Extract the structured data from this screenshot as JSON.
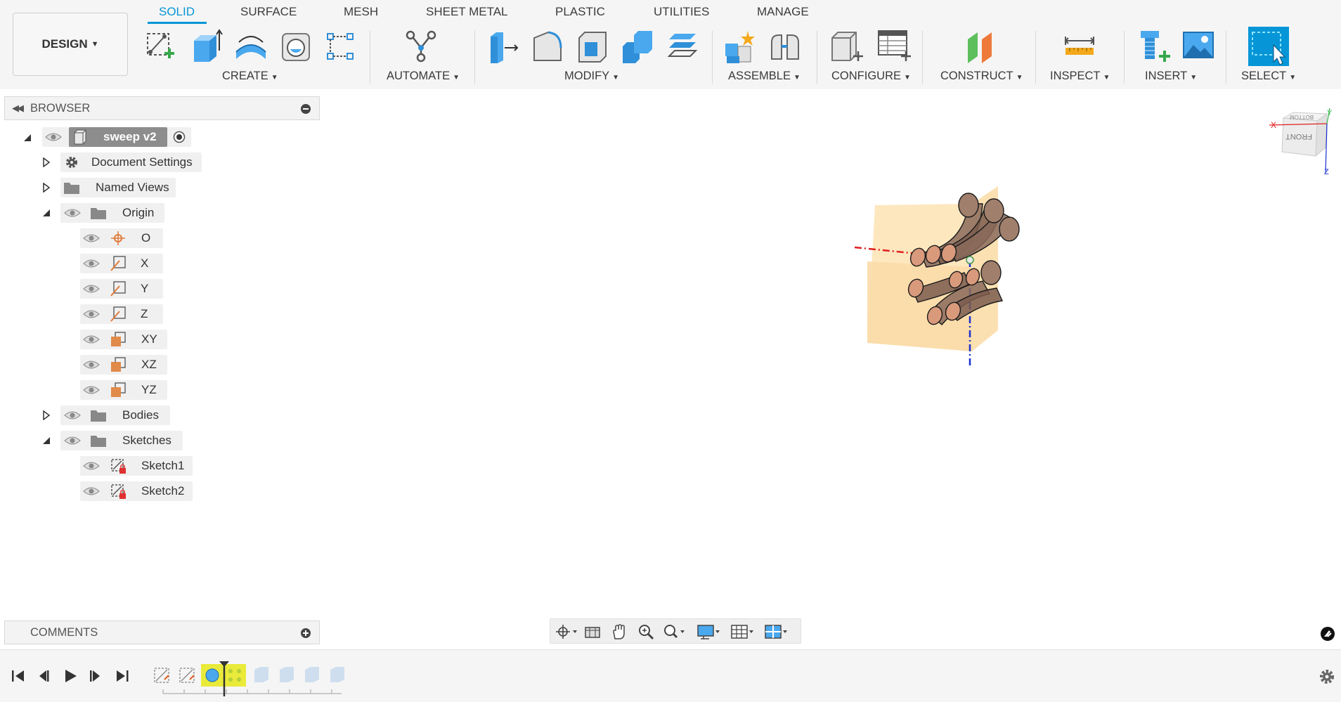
{
  "workspace": {
    "label": "DESIGN"
  },
  "tabs": [
    {
      "label": "SOLID",
      "active": true
    },
    {
      "label": "SURFACE"
    },
    {
      "label": "MESH"
    },
    {
      "label": "SHEET METAL"
    },
    {
      "label": "PLASTIC"
    },
    {
      "label": "UTILITIES"
    },
    {
      "label": "MANAGE"
    }
  ],
  "groups": {
    "create": "CREATE",
    "automate": "AUTOMATE",
    "modify": "MODIFY",
    "assemble": "ASSEMBLE",
    "configure": "CONFIGURE",
    "construct": "CONSTRUCT",
    "inspect": "INSPECT",
    "insert": "INSERT",
    "select": "SELECT"
  },
  "browser": {
    "title": "BROWSER",
    "root": "sweep v2",
    "items": {
      "document_settings": "Document Settings",
      "named_views": "Named Views",
      "origin": "Origin",
      "o": "O",
      "x": "X",
      "y": "Y",
      "z": "Z",
      "xy": "XY",
      "xz": "XZ",
      "yz": "YZ",
      "bodies": "Bodies",
      "sketches": "Sketches",
      "sketch1": "Sketch1",
      "sketch2": "Sketch2"
    }
  },
  "comments": {
    "title": "COMMENTS"
  },
  "viewcube": {
    "top_face": "BOTTOM",
    "front_face": "FRONT",
    "axis_x": "X",
    "axis_y": "Y",
    "axis_z": "Z"
  },
  "colors": {
    "accent": "#0696d7",
    "plane_fill": "#fde7bf",
    "tube_fill": "#8a6a5a",
    "tube_end": "#d99a7c",
    "axis_x": "#e02020",
    "axis_z": "#1a2fd0",
    "select_blue": "#0696d7"
  }
}
